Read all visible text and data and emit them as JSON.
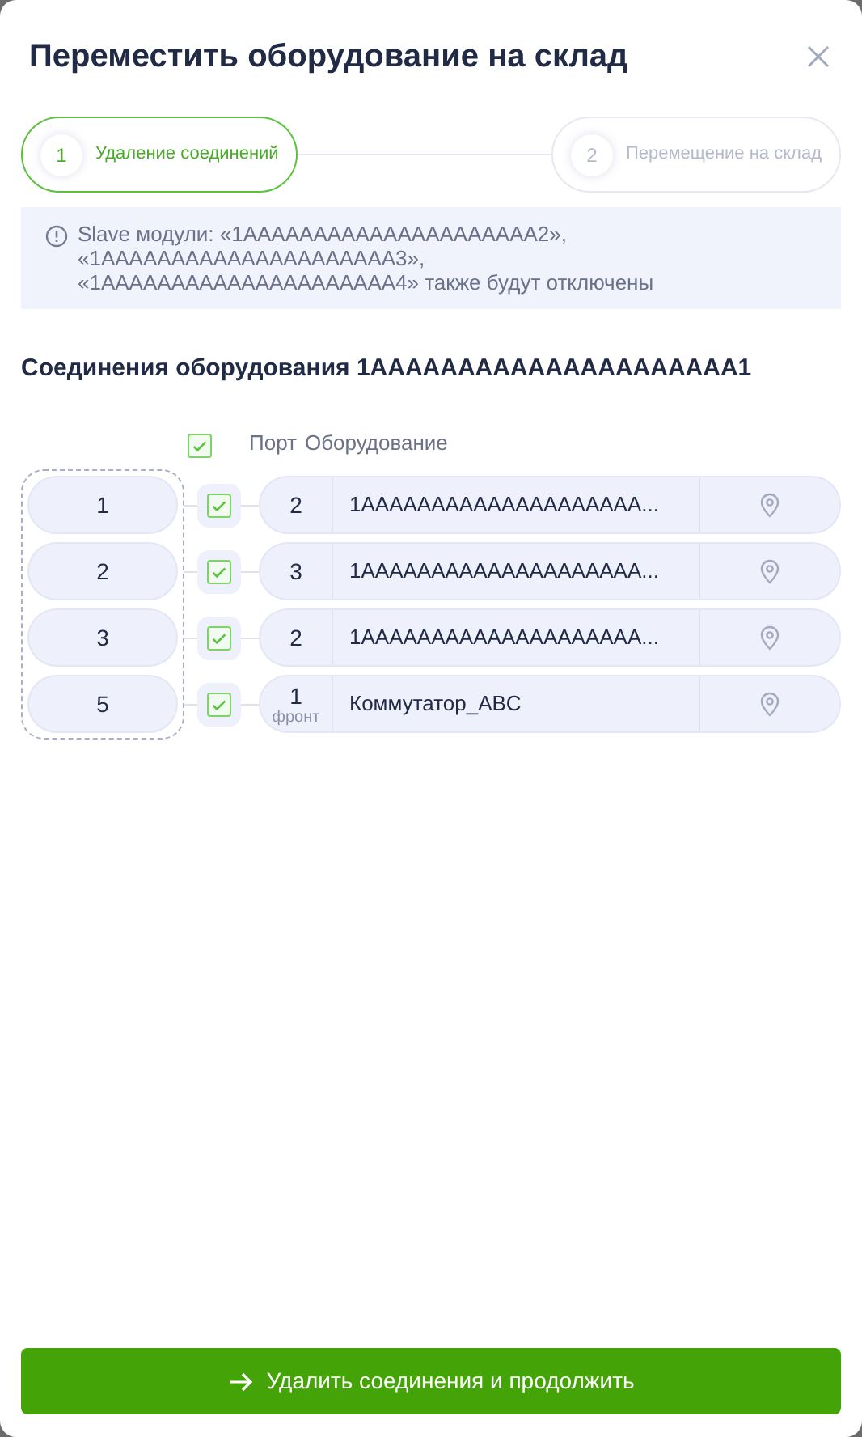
{
  "dialog": {
    "title": "Переместить оборудование на склад"
  },
  "steps": [
    {
      "number": "1",
      "label": "Удаление соединений",
      "selected": true
    },
    {
      "number": "2",
      "label": "Перемещение на склад",
      "selected": false
    }
  ],
  "notice": "Slave модули: «1AAAAAAAAAAAAAAAAAAAAA2», «1AAAAAAAAAAAAAAAAAAAAA3», «1AAAAAAAAAAAAAAAAAAAAA4» также будут отключены",
  "section_title": "Соединения оборудования 1AAAAAAAAAAAAAAAAAAAAA1",
  "table": {
    "select_all_checked": true,
    "columns": [
      "Порт",
      "Оборудование"
    ],
    "rows": [
      {
        "port": "1",
        "checked": true,
        "remote_port": "2",
        "equipment": "1AAAAAAAAAAAAAAAAAAAA..."
      },
      {
        "port": "2",
        "checked": true,
        "remote_port": "3",
        "equipment": "1AAAAAAAAAAAAAAAAAAAA..."
      },
      {
        "port": "3",
        "checked": true,
        "remote_port": "2",
        "equipment": "1AAAAAAAAAAAAAAAAAAAA..."
      },
      {
        "port": "5",
        "checked": true,
        "remote_port": "1",
        "remote_port_sub": "фронт",
        "equipment": "Коммутатор_ABC"
      }
    ]
  },
  "primary_button": "Удалить соединения и продолжить"
}
